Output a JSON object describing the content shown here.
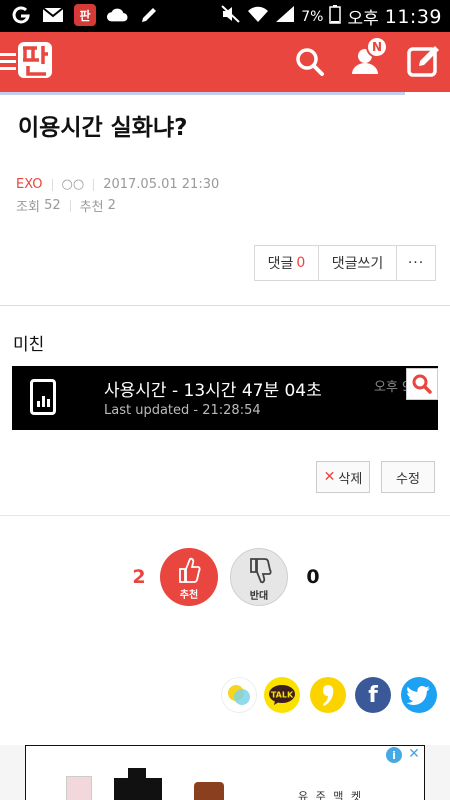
{
  "status_bar": {
    "battery": "7%",
    "ampm": "오후",
    "time": "11:39",
    "left_icons": [
      "g-icon",
      "mail-icon",
      "pann-app-icon",
      "cloud-icon",
      "pencil-icon"
    ],
    "pann_app_glyph": "판",
    "right_icons": [
      "mute-icon",
      "wifi-icon",
      "signal-icon",
      "battery-icon"
    ]
  },
  "header": {
    "logo_text": "판",
    "notification_badge": "N",
    "accent": "#e8463f",
    "scroll_progress": 0.9
  },
  "post": {
    "title": "이용시간 실화냐?",
    "author": "EXO",
    "user_id": "○○",
    "date": "2017.05.01 21:30",
    "views_label": "조회",
    "views": "52",
    "recommend_label": "추천",
    "recommend": "2",
    "body": "미친"
  },
  "comment_bar": {
    "comments_label": "댓글",
    "comments_count": "0",
    "write_label": "댓글쓰기",
    "more_label": "···"
  },
  "embedded_image": {
    "usage_text": "사용시간 - 13시간 47분 04초",
    "updated_text": "Last updated - 21:28:54",
    "corner_text": "오후 9"
  },
  "actions": {
    "delete_label": "삭제",
    "edit_label": "수정"
  },
  "vote": {
    "up_count": "2",
    "up_label": "추천",
    "down_label": "반대",
    "down_count": "0"
  },
  "share": {
    "icons": [
      "kakaostory-icon",
      "kakaotalk-icon",
      "comma-icon",
      "facebook-icon",
      "twitter-icon"
    ],
    "talk_label": "TALK",
    "facebook_glyph": "f"
  },
  "ad": {
    "info_label": "i",
    "close_label": "✕",
    "text": "유 주 맥 켓"
  }
}
